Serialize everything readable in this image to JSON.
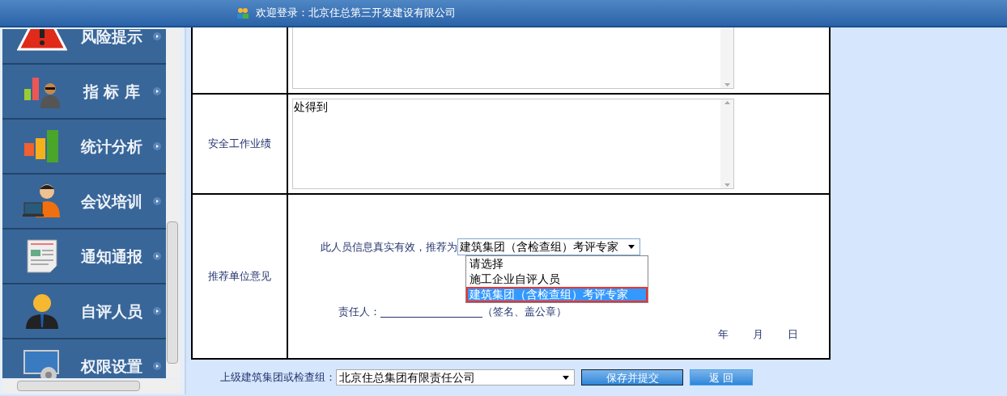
{
  "header": {
    "welcome": "欢迎登录：北京住总第三开发建设有限公司"
  },
  "sidebar": {
    "items": [
      {
        "label": "风险提示",
        "kind": "warning"
      },
      {
        "label": "指 标 库",
        "kind": "metrics"
      },
      {
        "label": "统计分析",
        "kind": "chart"
      },
      {
        "label": "会议培训",
        "kind": "training"
      },
      {
        "label": "通知通报",
        "kind": "notice"
      },
      {
        "label": "自评人员",
        "kind": "person"
      },
      {
        "label": "权限设置",
        "kind": "settings"
      }
    ]
  },
  "form": {
    "rows": [
      {
        "label": "",
        "kind": "textarea",
        "value": ""
      },
      {
        "label": "安全工作业绩",
        "kind": "textarea",
        "value": "处得到"
      },
      {
        "label": "推荐单位意见",
        "kind": "opinion",
        "statement": "此人员信息真实有效，推荐为",
        "select_value": "建筑集团（含检查组）考评专家",
        "options": [
          {
            "label": "请选择",
            "selected": false
          },
          {
            "label": "施工企业自评人员",
            "selected": false
          },
          {
            "label": "建筑集团（含检查组）考评专家",
            "selected": true
          }
        ],
        "signer_label": "责任人：",
        "signer_note": "（签名、盖公章）",
        "date": [
          "年",
          "月",
          "日"
        ]
      }
    ]
  },
  "footer": {
    "group_label": "上级建筑集团或检查组：",
    "group_value": "北京住总集团有限责任公司",
    "buttons": [
      "保存并提交",
      "返 回"
    ]
  }
}
